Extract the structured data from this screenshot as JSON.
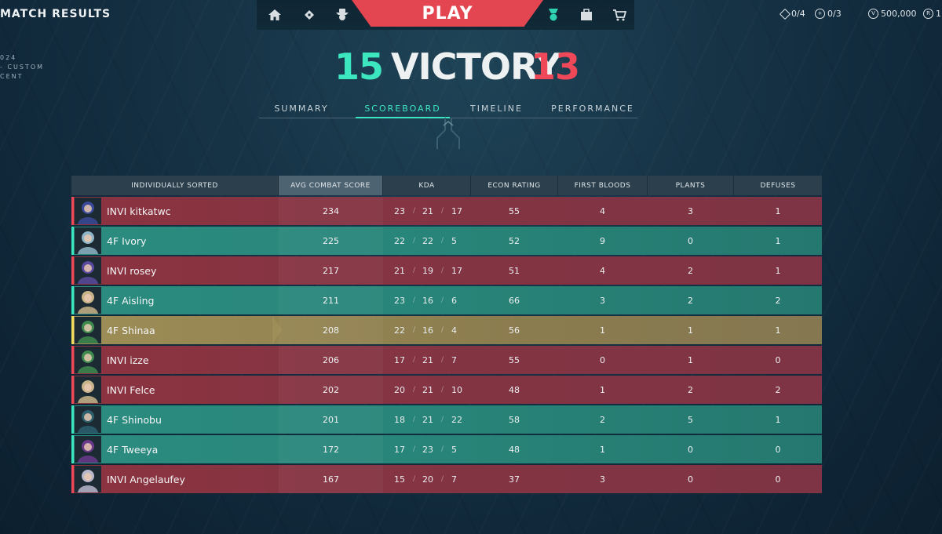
{
  "header": {
    "title": "MATCH RESULTS",
    "meta": [
      "024",
      "- CUSTOM",
      "CENT"
    ]
  },
  "nav": {
    "play_label": "PLAY",
    "icons": [
      "home-icon",
      "ticket-icon",
      "agent-icon",
      "medal-icon",
      "locker-icon",
      "cart-icon"
    ]
  },
  "currency": {
    "a": "0/4",
    "b": "0/3",
    "vp": "500,000",
    "r": "1"
  },
  "result": {
    "team_score": "15",
    "label": "VICTORY",
    "enemy_score": "13"
  },
  "tabs": [
    {
      "label": "SUMMARY",
      "active": false
    },
    {
      "label": "SCOREBOARD",
      "active": true
    },
    {
      "label": "TIMELINE",
      "active": false
    },
    {
      "label": "PERFORMANCE",
      "active": false
    }
  ],
  "columns": {
    "player": "INDIVIDUALLY SORTED",
    "acs": "AVG COMBAT SCORE",
    "kda": "KDA",
    "econ": "ECON RATING",
    "first_bloods": "FIRST BLOODS",
    "plants": "PLANTS",
    "defuses": "DEFUSES"
  },
  "rows": [
    {
      "team": "red",
      "name": "INVI kitkatwc",
      "acs": "234",
      "k": "23",
      "d": "21",
      "a": "17",
      "econ": "55",
      "fb": "4",
      "plants": "3",
      "defuses": "1",
      "agent_color": "#3b4a9a"
    },
    {
      "team": "teal",
      "name": "4F Ivory",
      "acs": "225",
      "k": "22",
      "d": "22",
      "a": "5",
      "econ": "52",
      "fb": "9",
      "plants": "0",
      "defuses": "1",
      "agent_color": "#8fb6c8"
    },
    {
      "team": "red",
      "name": "INVI rosey",
      "acs": "217",
      "k": "21",
      "d": "19",
      "a": "17",
      "econ": "51",
      "fb": "4",
      "plants": "2",
      "defuses": "1",
      "agent_color": "#5a4a9e"
    },
    {
      "team": "teal",
      "name": "4F Aisling",
      "acs": "211",
      "k": "23",
      "d": "16",
      "a": "6",
      "econ": "66",
      "fb": "3",
      "plants": "2",
      "defuses": "2",
      "agent_color": "#c9b48a"
    },
    {
      "team": "gold",
      "name": "4F Shinaa",
      "acs": "208",
      "k": "22",
      "d": "16",
      "a": "4",
      "econ": "56",
      "fb": "1",
      "plants": "1",
      "defuses": "1",
      "agent_color": "#3f8a4e"
    },
    {
      "team": "red",
      "name": "INVI izze",
      "acs": "206",
      "k": "17",
      "d": "21",
      "a": "7",
      "econ": "55",
      "fb": "0",
      "plants": "1",
      "defuses": "0",
      "agent_color": "#3f8a4e"
    },
    {
      "team": "red",
      "name": "INVI Felce",
      "acs": "202",
      "k": "20",
      "d": "21",
      "a": "10",
      "econ": "48",
      "fb": "1",
      "plants": "2",
      "defuses": "2",
      "agent_color": "#c9b48a"
    },
    {
      "team": "teal",
      "name": "4F Shinobu",
      "acs": "201",
      "k": "18",
      "d": "21",
      "a": "22",
      "econ": "58",
      "fb": "2",
      "plants": "5",
      "defuses": "1",
      "agent_color": "#2d5f6e"
    },
    {
      "team": "teal",
      "name": "4F Tweeya",
      "acs": "172",
      "k": "17",
      "d": "23",
      "a": "5",
      "econ": "48",
      "fb": "1",
      "plants": "0",
      "defuses": "0",
      "agent_color": "#6b3a8c"
    },
    {
      "team": "red",
      "name": "INVI Angelaufey",
      "acs": "167",
      "k": "15",
      "d": "20",
      "a": "7",
      "econ": "37",
      "fb": "3",
      "plants": "0",
      "defuses": "0",
      "agent_color": "#b8b6cc"
    }
  ]
}
